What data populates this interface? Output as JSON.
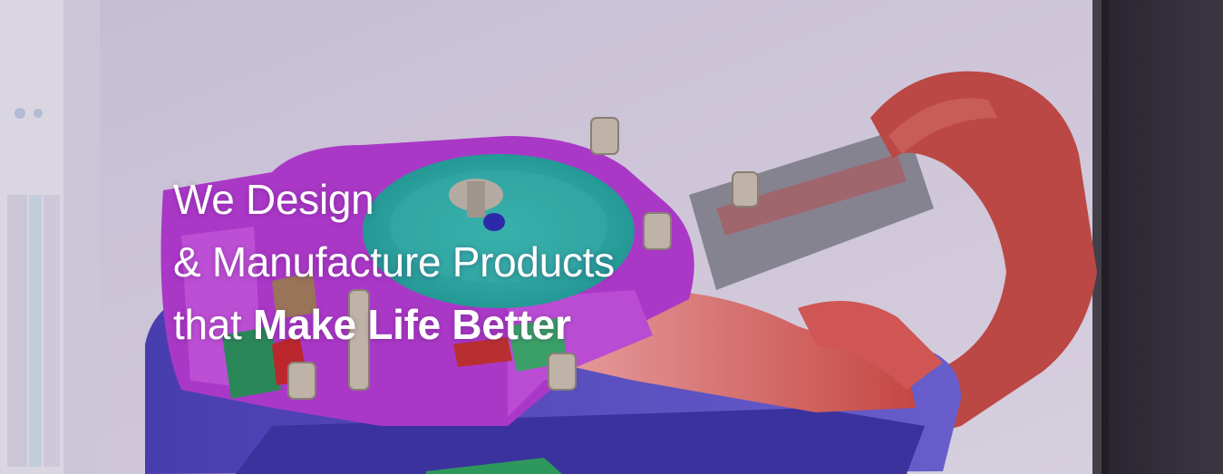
{
  "hero": {
    "line1": "We Design",
    "line2": "& Manufacture Products",
    "line3_prefix": "that ",
    "line3_emphasis": "Make Life Better",
    "text_color": "#ffffff",
    "background_image": "cad-3d-model-on-monitor"
  }
}
